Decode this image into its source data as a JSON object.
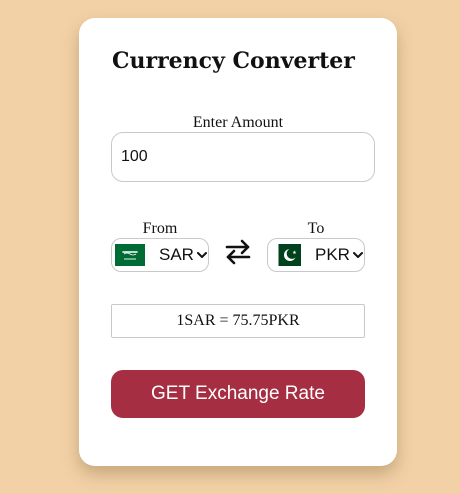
{
  "app": {
    "title": "Currency Converter"
  },
  "amount": {
    "label": "Enter Amount",
    "value": "100"
  },
  "from": {
    "label": "From",
    "currency": "SAR",
    "flag_icon": "saudi-arabia-flag-icon"
  },
  "to": {
    "label": "To",
    "currency": "PKR",
    "flag_icon": "pakistan-flag-icon"
  },
  "swap": {
    "icon": "swap-arrows-icon"
  },
  "result": {
    "text": "1SAR = 75.75PKR"
  },
  "action": {
    "button_label": "GET Exchange Rate"
  },
  "colors": {
    "background": "#f1d1a5",
    "button": "#a62e43",
    "saudi_green": "#006c35",
    "pakistan_green": "#01411c"
  }
}
